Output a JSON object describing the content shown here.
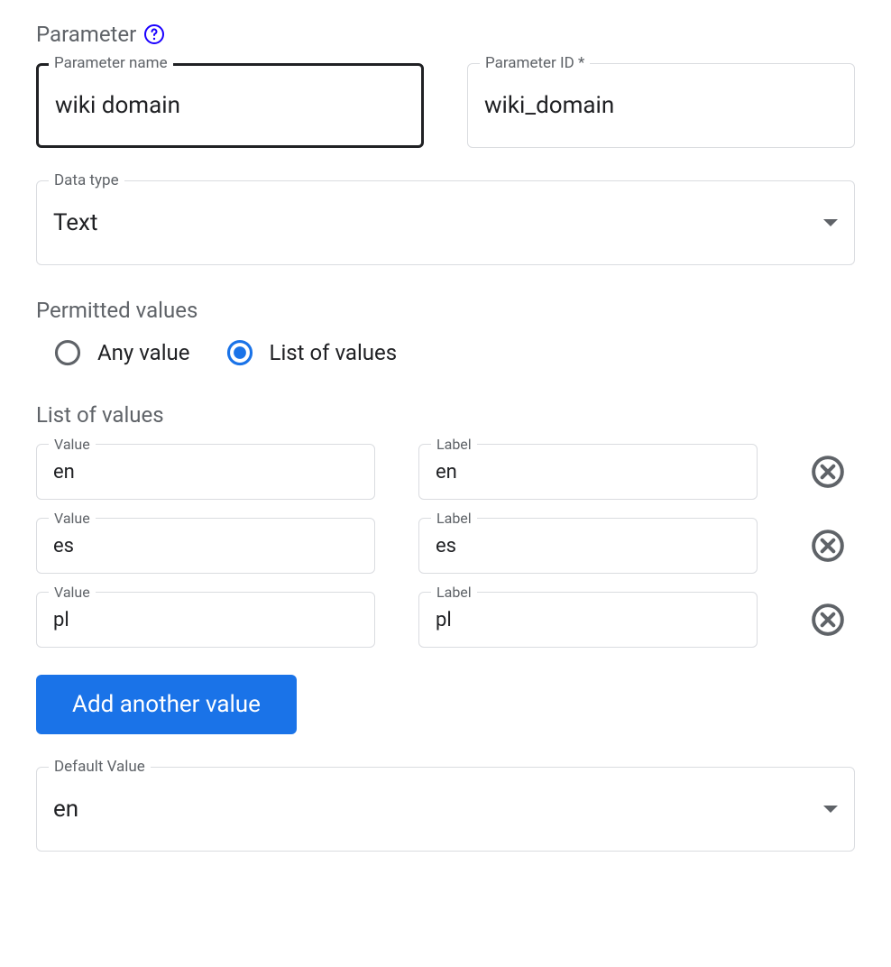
{
  "section_title": "Parameter",
  "param_name": {
    "label": "Parameter name",
    "value": "wiki domain"
  },
  "param_id": {
    "label": "Parameter ID *",
    "value": "wiki_domain"
  },
  "data_type": {
    "label": "Data type",
    "value": "Text"
  },
  "permitted": {
    "title": "Permitted values",
    "any_label": "Any value",
    "list_label": "List of values",
    "selected": "list"
  },
  "list_title": "List of values",
  "value_col_label": "Value",
  "label_col_label": "Label",
  "rows": [
    {
      "value": "en",
      "label": "en"
    },
    {
      "value": "es",
      "label": "es"
    },
    {
      "value": "pl",
      "label": "pl"
    }
  ],
  "add_button": "Add another value",
  "default_value": {
    "label": "Default Value",
    "value": "en"
  }
}
